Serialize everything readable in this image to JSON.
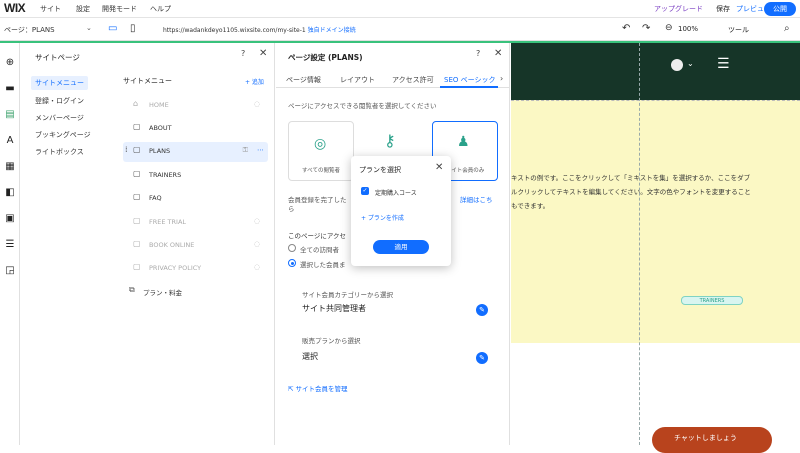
{
  "topbar": {
    "logo": "WIX",
    "menu": [
      "サイト",
      "設定",
      "開発モード",
      "ヘルプ"
    ],
    "upgrade": "アップグレード",
    "save": "保存",
    "preview": "プレビュー",
    "publish": "公開"
  },
  "toolbar": {
    "page_select": "ページ：PLANS",
    "url": "https://wadankdeyo1105.wixsite.com/my-site-1",
    "domain_link": "独自ドメイン接続",
    "zoom": "100%",
    "tools": "ツール"
  },
  "site_pages": {
    "title": "サイトページ",
    "help": "?",
    "categories": [
      "サイトメニュー",
      "登録・ログイン",
      "メンバーページ",
      "ブッキングページ",
      "ライトボックス"
    ],
    "list_title": "サイトメニュー",
    "add": "+ 追加",
    "pages": [
      {
        "label": "HOME",
        "icon": "home-icon",
        "hidden": true
      },
      {
        "label": "ABOUT",
        "icon": "page-icon",
        "hidden": false
      },
      {
        "label": "PLANS",
        "icon": "page-icon",
        "hidden": false,
        "selected": true
      },
      {
        "label": "TRAINERS",
        "icon": "page-icon",
        "hidden": false
      },
      {
        "label": "FAQ",
        "icon": "page-icon",
        "hidden": false
      },
      {
        "label": "FREE TRIAL",
        "icon": "page-icon",
        "hidden": true
      },
      {
        "label": "BOOK ONLINE",
        "icon": "page-icon",
        "hidden": true
      },
      {
        "label": "PRIVACY POLICY",
        "icon": "page-icon",
        "hidden": true
      },
      {
        "label": "プラン・料金",
        "icon": "folder-icon",
        "hidden": false
      }
    ]
  },
  "page_settings": {
    "title": "ページ設定 (PLANS)",
    "tabs": [
      "ページ情報",
      "レイアウト",
      "アクセス許可",
      "SEO ベーシック"
    ],
    "prompt": "ページにアクセスできる閲覧者を選択してください",
    "cards": [
      "すべての閲覧者",
      "",
      "サイト会員のみ"
    ],
    "member_line": "会員登録を完了した",
    "member_line_suffix": "ら",
    "details_link": "詳細はこち",
    "access_heading": "このページにアクセ",
    "radio_all": "全ての訪問者",
    "radio_selected": "選択した会員ま",
    "category_label": "サイト会員カテゴリーから選択",
    "category_value": "サイト共同管理者",
    "plan_label": "販売プランから選択",
    "plan_value": "選択",
    "manage_link": "サイト会員を管理"
  },
  "popup": {
    "title": "プランを選択",
    "option": "定期購入コース",
    "create": "+ プランを作成",
    "apply": "適用"
  },
  "canvas": {
    "text": "キストの例です。ここをクリックして「ミキストを集」を選択するか、ここをダブルクリックしてテキストを編集してください。文字の色やフォントを変更することもできます。",
    "trainers_tag": "TRAINERS",
    "chat": "チャットしましょう"
  },
  "colors": {
    "accent": "#116dff",
    "green_line": "#39c27c",
    "header_dark": "#163528",
    "yellow": "#fbf8c4",
    "chat": "#b8431d"
  }
}
